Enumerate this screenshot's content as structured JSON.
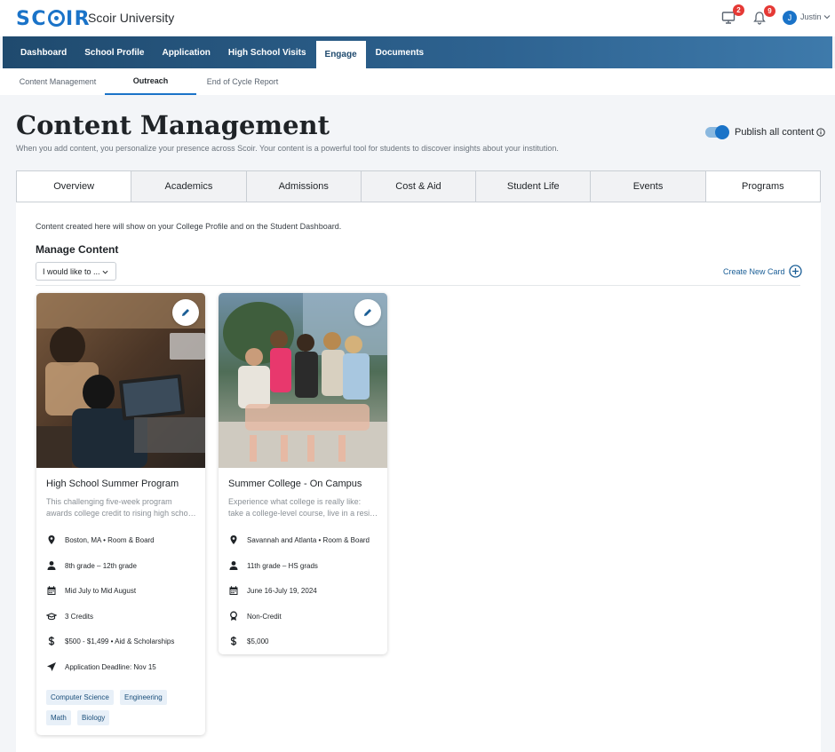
{
  "brand": {
    "logo_text": "SCOIR",
    "org_name": "Scoir University"
  },
  "topbar": {
    "messages_count": "2",
    "notifications_count": "9",
    "user_initial": "J",
    "user_name": "Justin"
  },
  "main_nav": [
    "Dashboard",
    "School Profile",
    "Application",
    "High School Visits",
    "Engage",
    "Documents"
  ],
  "sub_nav": [
    "Content Management",
    "Outreach",
    "End of Cycle Report"
  ],
  "page": {
    "title": "Content Management",
    "description": "When you add content, you personalize your presence across Scoir. Your content is a powerful tool for students to discover insights about your institution.",
    "publish_label": "Publish all content"
  },
  "tabs": [
    "Overview",
    "Academics",
    "Admissions",
    "Cost & Aid",
    "Student Life",
    "Events",
    "Programs"
  ],
  "panel": {
    "note": "Content created here will show on your College Profile and on the Student Dashboard.",
    "manage_title": "Manage Content",
    "dropdown_value": "I would like to ...",
    "create_label": "Create New Card"
  },
  "cards": [
    {
      "title": "High School Summer Program",
      "desc_line1": "This challenging five-week program",
      "desc_line2": "awards college credit to rising high school students",
      "location": "Boston, MA • Room & Board",
      "grades": "8th grade – 12th grade",
      "dates": "Mid July to Mid August",
      "credits": "3 Credits",
      "cost": "$500 - $1,499 • Aid & Scholarships",
      "deadline": "Application Deadline: Nov 15",
      "tags": [
        "Computer Science",
        "Engineering",
        "Math",
        "Biology"
      ]
    },
    {
      "title": "Summer College - On Campus",
      "desc_line1": "Experience what college is really like:",
      "desc_line2": "take a college-level course, live in a residence hall",
      "location": "Savannah and Atlanta • Room & Board",
      "grades": "11th grade – HS grads",
      "dates": "June 16-July 19, 2024",
      "credits": "Non-Credit",
      "cost": "$5,000"
    }
  ],
  "colors": {
    "accent": "#1a73c8",
    "nav_dark": "#1f4a6e",
    "badge": "#e53935"
  }
}
